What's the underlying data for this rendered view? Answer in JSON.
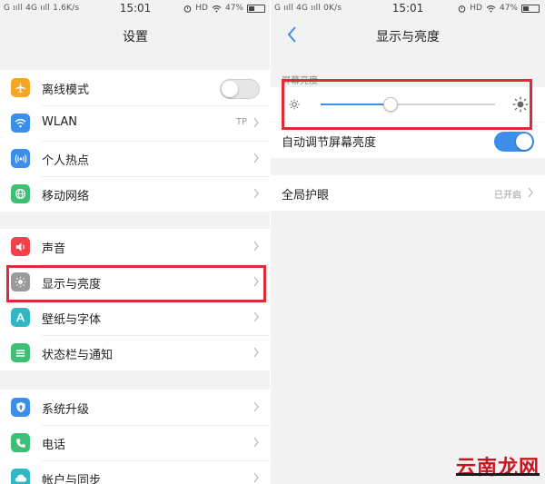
{
  "left": {
    "status": {
      "signal": "G ııll 4G ııll 1.6K/s",
      "time": "15:01",
      "hd": "HD",
      "battery": "47%",
      "battery_level": 0.47
    },
    "title": "设置",
    "items": [
      {
        "label": "离线模式",
        "icon": "airplane-icon",
        "color": "#f5a623"
      },
      {
        "label": "WLAN",
        "value": "TP",
        "icon": "wifi-icon",
        "color": "#3b8ee9"
      },
      {
        "label": "个人热点",
        "icon": "hotspot-icon",
        "color": "#3b8ee9"
      },
      {
        "label": "移动网络",
        "icon": "globe-icon",
        "color": "#3fbf74"
      },
      {
        "label": "声音",
        "icon": "speaker-icon",
        "color": "#f0424e"
      },
      {
        "label": "显示与亮度",
        "icon": "brightness-icon",
        "color": "#9a9a9a"
      },
      {
        "label": "壁纸与字体",
        "icon": "brush-icon",
        "color": "#2fb8c4"
      },
      {
        "label": "状态栏与通知",
        "icon": "list-icon",
        "color": "#3fbf74"
      },
      {
        "label": "系统升级",
        "icon": "upgrade-icon",
        "color": "#3b8ee9"
      },
      {
        "label": "电话",
        "icon": "phone-icon",
        "color": "#3fbf74"
      },
      {
        "label": "帐户与同步",
        "icon": "cloud-icon",
        "color": "#2fb8c4"
      }
    ],
    "airplane_mode_on": false
  },
  "right": {
    "status": {
      "signal": "G ııll 4G ııll 0K/s",
      "time": "15:01",
      "hd": "HD",
      "battery": "47%",
      "battery_level": 0.47
    },
    "title": "显示与亮度",
    "brightness_label": "屏幕亮度",
    "brightness_level": 0.4,
    "auto_brightness_label": "自动调节屏幕亮度",
    "auto_brightness_on": true,
    "eye_care_label": "全局护眼",
    "eye_care_value": "已开启"
  },
  "accent_color": "#3b8ee9",
  "highlight_color": "#e02a36",
  "watermark": "云南龙网"
}
